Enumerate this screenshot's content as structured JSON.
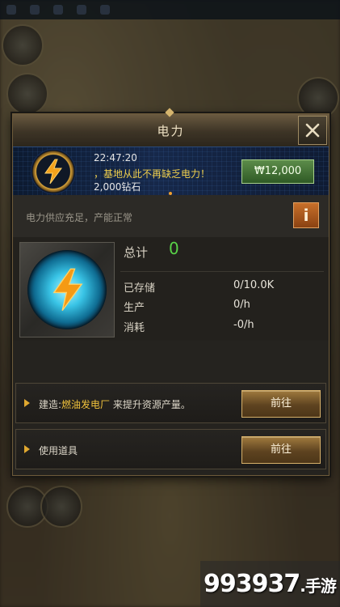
{
  "colors": {
    "accent_gold": "#d6b06a",
    "positive_green": "#58d247",
    "message_yellow": "#f0cf4c",
    "energy_cyan": "#39c4e6",
    "bolt_orange": "#f5a21b"
  },
  "dialog": {
    "title": "电力",
    "close_icon": "close-icon"
  },
  "banner": {
    "time": "22:47:20",
    "message": "，基地从此不再缺乏电力！",
    "reward": "2,000钻石",
    "price": "₩12,000",
    "icon": "lightning-icon"
  },
  "status": {
    "text": "电力供应充足，产能正常",
    "info_label": "i"
  },
  "resource": {
    "icon": "lightning-icon",
    "total_label": "总计",
    "total_value": "0",
    "stored_label": "已存储",
    "stored_value": "0/10.0K",
    "production_label": "生产",
    "production_value": "0/h",
    "consumption_label": "消耗",
    "consumption_value": "-0/h"
  },
  "actions": [
    {
      "prefix": "建造:",
      "highlight": "燃油发电厂",
      "suffix": " 来提升资源产量。",
      "button": "前往"
    },
    {
      "prefix": "使用道具",
      "highlight": "",
      "suffix": "",
      "button": "前往"
    }
  ],
  "watermark": {
    "number": "993937",
    "suffix": ".手游"
  }
}
